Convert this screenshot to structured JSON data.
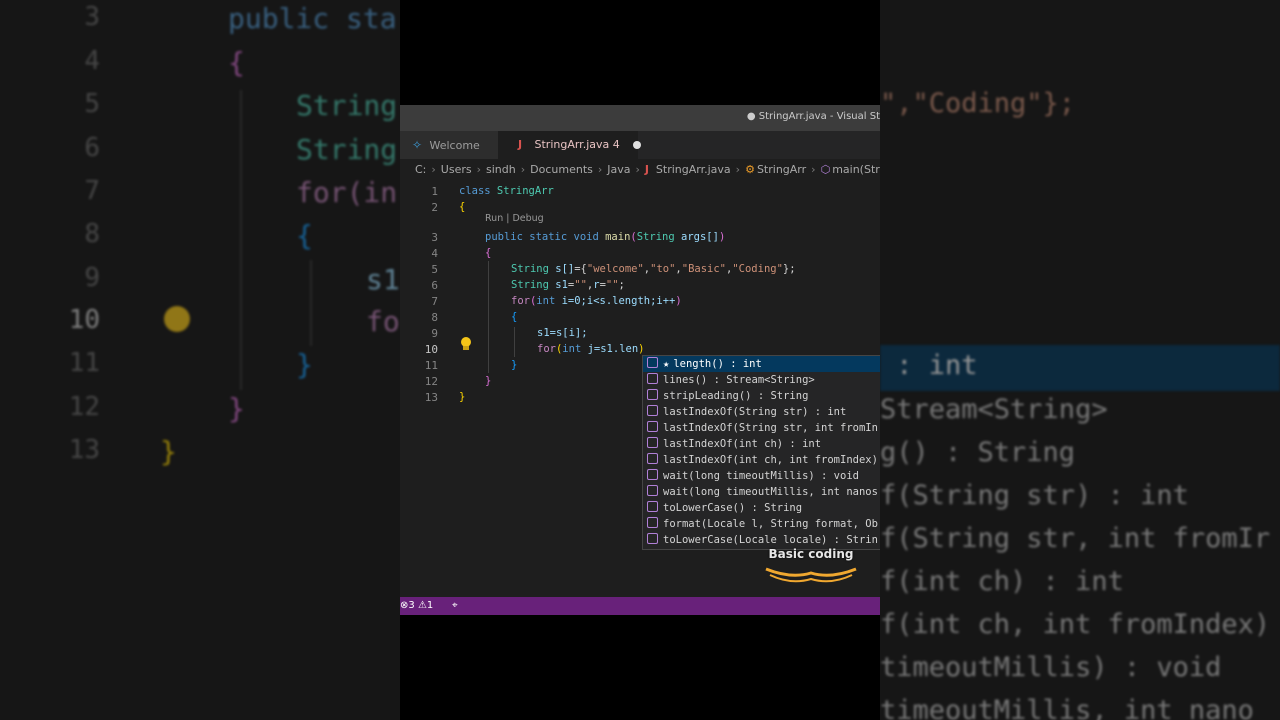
{
  "window": {
    "title": "● StringArr.java - Visual St"
  },
  "tabs": [
    {
      "label": "Welcome",
      "icon": "vscode-icon"
    },
    {
      "label": "StringArr.java 4",
      "icon": "java-icon",
      "dirty": true
    }
  ],
  "breadcrumb": [
    "C:",
    "Users",
    "sindh",
    "Documents",
    "Java",
    "StringArr.java",
    "StringArr",
    "main(String[])"
  ],
  "codelens": {
    "run": "Run",
    "sep": " | ",
    "debug": "Debug"
  },
  "line_numbers": [
    "1",
    "2",
    "3",
    "4",
    "5",
    "6",
    "7",
    "8",
    "9",
    "10",
    "11",
    "12",
    "13"
  ],
  "active_line": "10",
  "code": {
    "l1a": "class",
    "l1b": " StringArr",
    "l2": "{",
    "l3a": "public static void ",
    "l3b": "main",
    "l3c": "(",
    "l3d": "String",
    "l3e": " args[]",
    "l3f": ")",
    "l4": "{",
    "l5a": "String ",
    "l5b": "s[]",
    "l5c": "={",
    "l5d": "\"welcome\"",
    "l5e": ",",
    "l5f": "\"to\"",
    "l5g": ",",
    "l5h": "\"Basic\"",
    "l5i": ",",
    "l5j": "\"Coding\"",
    "l5k": "};",
    "l6a": "String ",
    "l6b": "s1",
    "l6c": "=",
    "l6d": "\"\"",
    "l6e": ",",
    "l6f": "r",
    "l6g": "=",
    "l6h": "\"\"",
    "l6i": ";",
    "l7a": "for",
    "l7b": "(",
    "l7c": "int",
    "l7d": " i=0;i<s.length;i++",
    "l7e": ")",
    "l8": "{",
    "l9": "s1=s[i];",
    "l10a": "for",
    "l10b": "(",
    "l10c": "int",
    "l10d": " j=s1.len",
    "l10e": ")",
    "l11": "}",
    "l12": "}",
    "l13": "}"
  },
  "suggestions": [
    {
      "label": "length() : int",
      "starred": true
    },
    {
      "label": "lines() : Stream<String>"
    },
    {
      "label": "stripLeading() : String"
    },
    {
      "label": "lastIndexOf(String str) : int"
    },
    {
      "label": "lastIndexOf(String str, int fromIn"
    },
    {
      "label": "lastIndexOf(int ch) : int"
    },
    {
      "label": "lastIndexOf(int ch, int fromIndex)"
    },
    {
      "label": "wait(long timeoutMillis) : void"
    },
    {
      "label": "wait(long timeoutMillis, int nanos"
    },
    {
      "label": "toLowerCase() : String"
    },
    {
      "label": "format(Locale l, String format, Ob"
    },
    {
      "label": "toLowerCase(Locale locale) : Strin"
    }
  ],
  "watermark": {
    "text": "Basic coding"
  },
  "statusbar": {
    "errors": "3",
    "warnings": "1"
  },
  "background_left": {
    "line_numbers": [
      "3",
      "4",
      "5",
      "6",
      "7",
      "8",
      "9",
      "10",
      "11",
      "12",
      "13"
    ],
    "l3": "public sta",
    "l4": "{",
    "l5": "String",
    "l6": "String",
    "l7": "for(in",
    "l8": "{",
    "l9": "s1",
    "l10": "for",
    "l11": "}",
    "l12": "}",
    "l13": "}"
  },
  "background_right": {
    "l0": "\",\"Coding\"};",
    "l1": " : int",
    "l2": "Stream<String>",
    "l3": "g() : String",
    "l4": "f(String str) : int",
    "l5": "f(String str, int fromIr",
    "l6": "f(int ch) : int",
    "l7": "f(int ch, int fromIndex)",
    "l8": "timeoutMillis) : void",
    "l9": "timeoutMillis, int nano"
  },
  "colors": {
    "statusbar": "#68217a",
    "selection": "#04395e",
    "editor_bg": "#1e1e1e"
  }
}
